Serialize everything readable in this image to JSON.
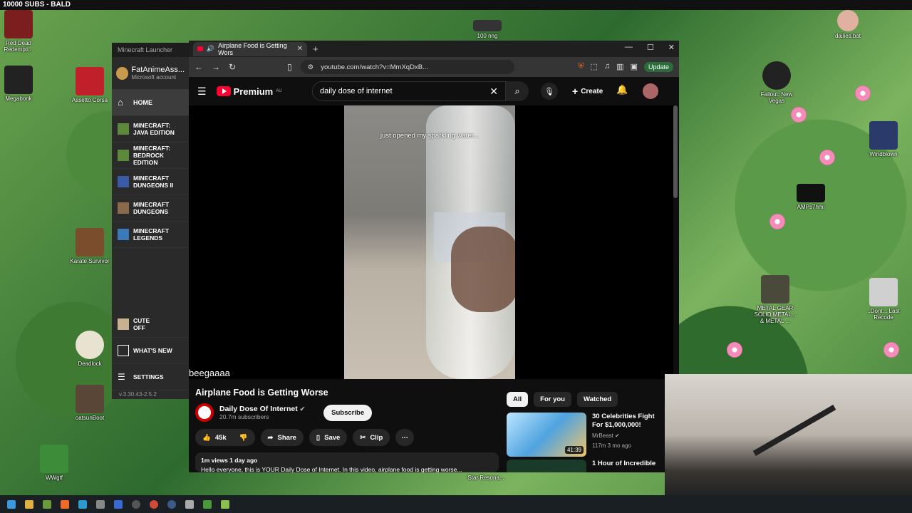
{
  "overlay": {
    "subs_banner": "10000 SUBS - BALD"
  },
  "desktop_icons": {
    "red_dead": "Red Dead Redempti...",
    "megabonk": "Megabonk",
    "assetto": "Assetto Corsa",
    "karate": "Karate Survivor",
    "deadlock": "Deadlock",
    "oatsun": "oatsunBoot",
    "wwgtf": "WWgtf",
    "fallout": "Fallout: New Vegas",
    "windblown": "Windblown",
    "amps": "AMPs7hmi",
    "mgs": "METAL GEAR SOLID METAL... & METAL ...",
    "last_recode": "..Dont... Last Recode",
    "dailies": "dailies.bat",
    "nong": "100 nng",
    "star": "Star Resona..."
  },
  "minecraft": {
    "window_title": "Minecraft Launcher",
    "account_name": "FatAnimeAss...",
    "account_sub": "Microsoft account",
    "home": "HOME",
    "java": "MINECRAFT: JAVA EDITION",
    "bedrock": "MINECRAFT: BEDROCK EDITION",
    "dungeons2": "MINECRAFT DUNGEONS II",
    "dungeons": "MINECRAFT DUNGEONS",
    "legends": "MINECRAFT LEGENDS",
    "cute": "CUTE",
    "cute_state": "OFF",
    "whats_new": "WHAT'S NEW",
    "settings": "SETTINGS",
    "version": "v.3.30.43-2.5.2"
  },
  "browser": {
    "tab_title": "Airplane Food is Getting Wors",
    "url": "youtube.com/watch?v=MmXqDxB...",
    "update": "Update"
  },
  "youtube": {
    "brand": "Premium",
    "region": "AU",
    "search_query": "daily dose of internet",
    "create": "Create",
    "video_caption": "just opened my sparkling water...",
    "chat_overlay": "beegaaaa",
    "video_title": "Airplane Food is Getting Worse",
    "channel_name": "Daily Dose Of Internet",
    "subscribers": "20.7m subscribers",
    "subscribe": "Subscribe",
    "likes": "45k",
    "share": "Share",
    "save": "Save",
    "clip": "Clip",
    "views_date": "1m views  1 day ago",
    "description": "Hello everyone, this is YOUR Daily Dose of Internet. In this video, airplane food is getting worse...",
    "chips": [
      "All",
      "For you",
      "Watched"
    ],
    "rec1": {
      "title": "30 Celebrities Fight For $1,000,000!",
      "channel": "MrBeast",
      "meta": "117m  3 mo ago",
      "duration": "41:39"
    },
    "rec2": {
      "title": "1 Hour of Incredible"
    }
  }
}
